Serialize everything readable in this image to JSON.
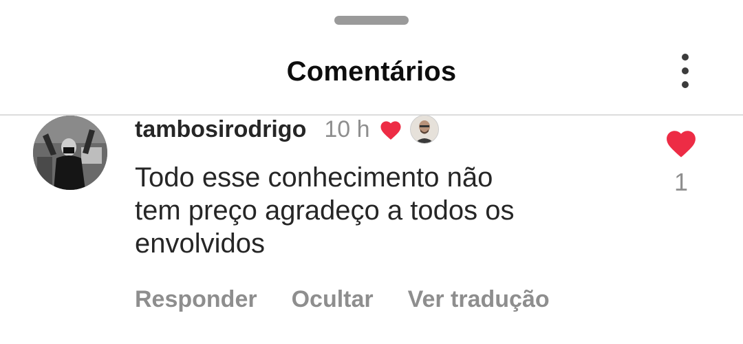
{
  "sheet": {
    "title": "Comentários",
    "menu_icon": "more-vertical-icon"
  },
  "comment": {
    "username": "tambosirodrigo",
    "time": "10 h",
    "creator_liked_icon": "heart-icon",
    "text_lines": [
      "Todo esse conhecimento não",
      "tem preço agradeço a todos os",
      "envolvidos"
    ],
    "like_icon": "heart-icon",
    "like_count": "1",
    "actions": [
      "Responder",
      "Ocultar",
      "Ver tradução"
    ]
  },
  "colors": {
    "heart": "#ed2c45",
    "secondary_text": "#8e8e8e",
    "primary_text": "#262626"
  }
}
